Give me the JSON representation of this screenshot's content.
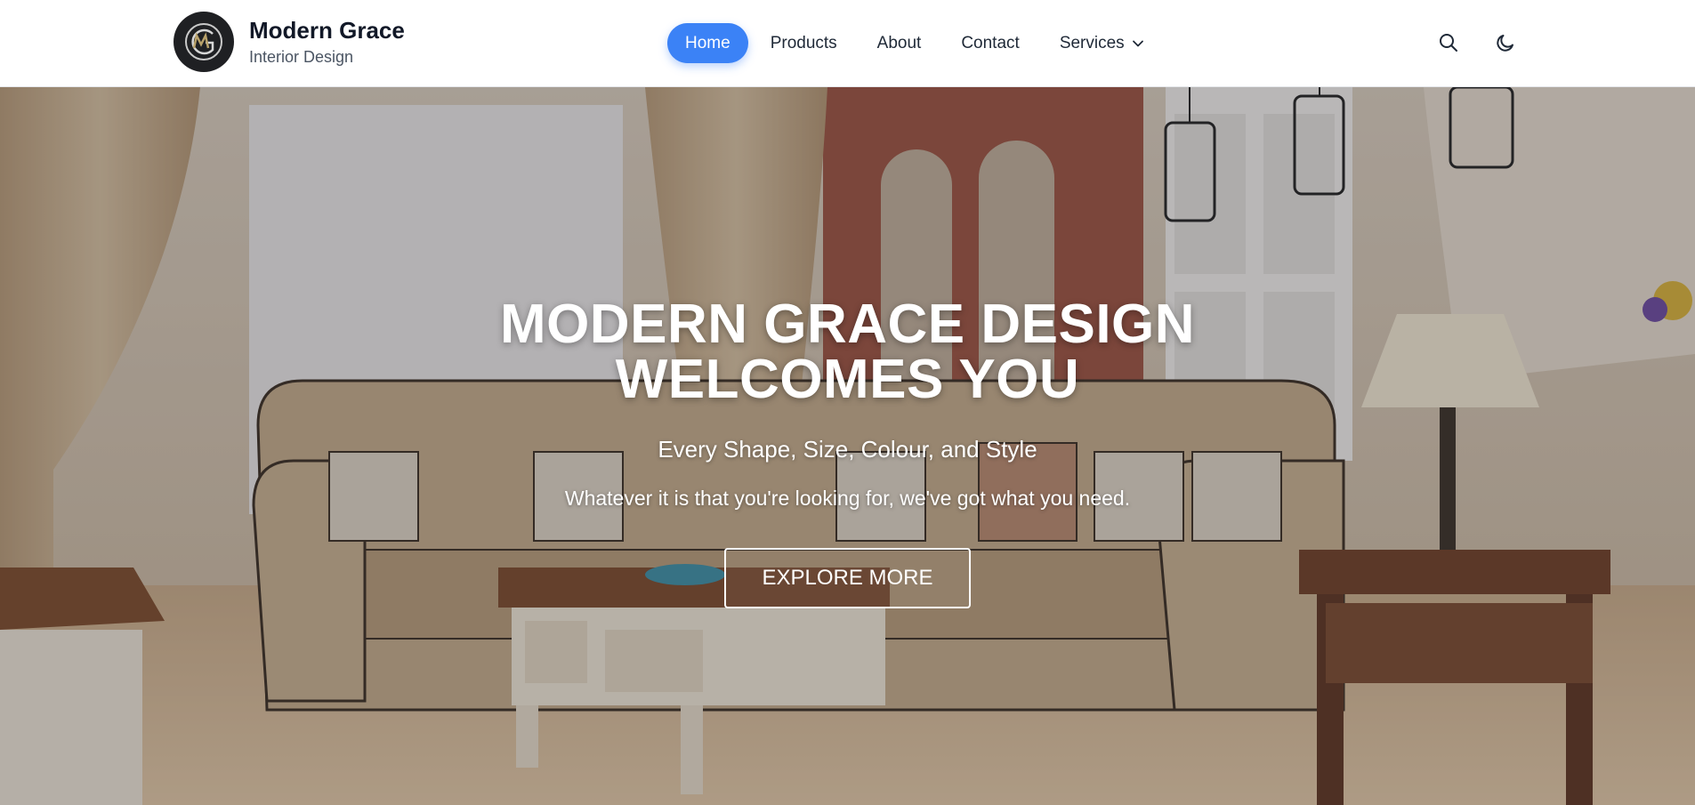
{
  "brand": {
    "logo_icon": "mg-monogram-logo",
    "title": "Modern Grace",
    "subtitle": "Interior Design"
  },
  "nav": {
    "items": [
      {
        "label": "Home",
        "active": true
      },
      {
        "label": "Products",
        "active": false
      },
      {
        "label": "About",
        "active": false
      },
      {
        "label": "Contact",
        "active": false
      },
      {
        "label": "Services",
        "active": false,
        "icon": "chevron-down-icon"
      }
    ]
  },
  "header_icons": [
    "search-icon",
    "moon-icon"
  ],
  "hero": {
    "title_line1": "MODERN GRACE DESIGN",
    "title_line2": "WELCOMES YOU",
    "subtitle": "Every Shape, Size, Colour, and Style",
    "description": "Whatever it is that you're looking for, we've got what you need.",
    "cta_label": "EXPLORE MORE"
  },
  "colors": {
    "accent": "#3b82f6",
    "text_dark": "#111827",
    "text_muted": "#4b5563",
    "hero_text": "#ffffff"
  }
}
